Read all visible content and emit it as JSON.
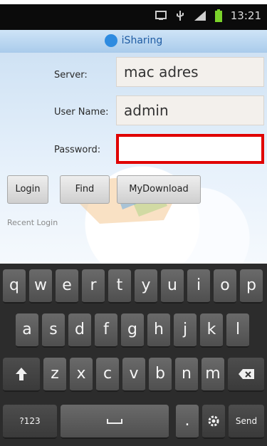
{
  "status_bar": {
    "time": "13:21"
  },
  "app_bar": {
    "title": "iSharing"
  },
  "form": {
    "server_label": "Server:",
    "server_value": "mac adres",
    "username_label": "User Name:",
    "username_value": "admin",
    "password_label": "Password:",
    "password_value": ""
  },
  "buttons": {
    "login": "Login",
    "find": "Find",
    "mydownload": "MyDownload"
  },
  "recent_login_label": "Recent Login",
  "keyboard": {
    "row1": [
      "q",
      "w",
      "e",
      "r",
      "t",
      "y",
      "u",
      "i",
      "o",
      "p"
    ],
    "row2": [
      "a",
      "s",
      "d",
      "f",
      "g",
      "h",
      "j",
      "k",
      "l"
    ],
    "row3": [
      "z",
      "x",
      "c",
      "v",
      "b",
      "n",
      "m"
    ],
    "symbols_key": "?123",
    "period_key": ".",
    "send_key": "Send"
  },
  "colors": {
    "accent": "#e00000",
    "keyboard_bg": "#2c2c2c",
    "titlebar": "#a9cbeb"
  },
  "icons": [
    "screen-icon",
    "usb-icon",
    "signal-icon",
    "battery-icon",
    "app-logo-icon",
    "shift-icon",
    "backspace-icon",
    "space-icon",
    "settings-icon"
  ]
}
